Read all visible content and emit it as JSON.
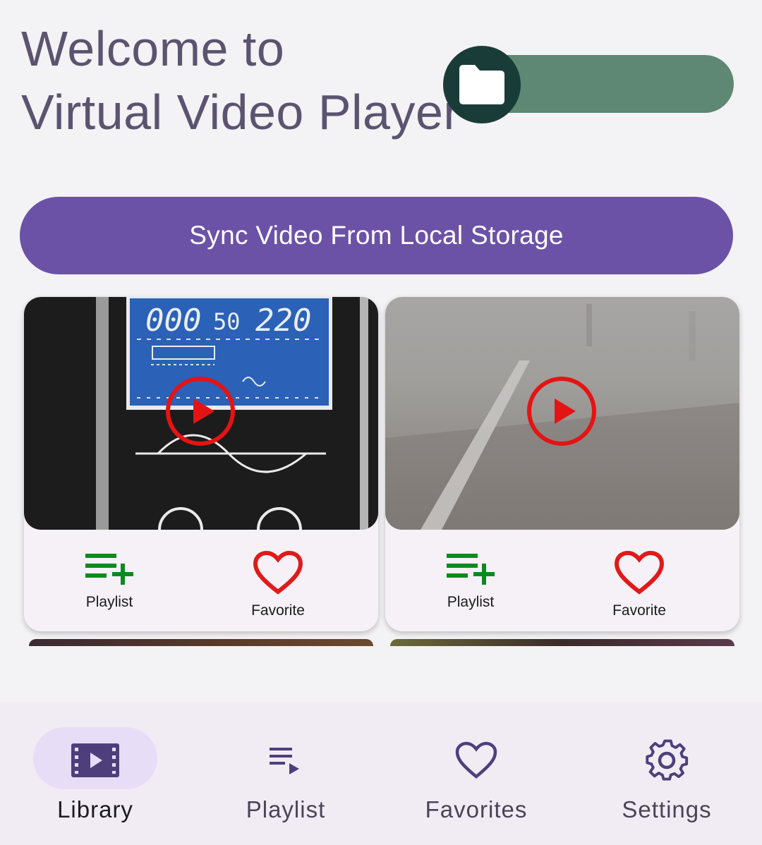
{
  "header": {
    "title_line1": "Welcome to",
    "title_line2": "Virtual Video Player",
    "toggle": {
      "icon": "folder-icon",
      "track_color": "#5e8774",
      "knob_color": "#1a3c38"
    }
  },
  "sync_button": {
    "label": "Sync Video From Local Storage",
    "color": "#6b52a6"
  },
  "videos": [
    {
      "thumbnail": "inverter-display",
      "play_icon": "play-circle-icon",
      "actions": {
        "playlist_label": "Playlist",
        "favorite_label": "Favorite"
      }
    },
    {
      "thumbnail": "foggy-road",
      "play_icon": "play-circle-icon",
      "actions": {
        "playlist_label": "Playlist",
        "favorite_label": "Favorite"
      }
    }
  ],
  "action_colors": {
    "playlist_add": "#0d8a1e",
    "favorite": "#e01a1a",
    "play": "#e41414"
  },
  "bottom_nav": {
    "items": [
      {
        "label": "Library",
        "icon": "video-library-icon",
        "active": true
      },
      {
        "label": "Playlist",
        "icon": "playlist-icon",
        "active": false
      },
      {
        "label": "Favorites",
        "icon": "heart-icon",
        "active": false
      },
      {
        "label": "Settings",
        "icon": "gear-icon",
        "active": false
      }
    ],
    "active_pill_color": "#e8ddf6",
    "icon_color": "#4e3f7c"
  }
}
